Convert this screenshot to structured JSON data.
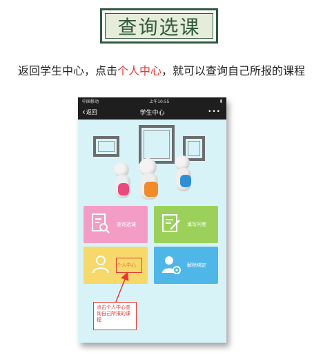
{
  "header": {
    "title": "查询选课",
    "instruction_prefix": "返回学生中心，点击",
    "instruction_highlight": "个人中心",
    "instruction_suffix": "，就可以查询自己所报的课程"
  },
  "phone": {
    "status": {
      "carrier": "中国移动",
      "time": "上午10:55"
    },
    "navbar": {
      "back_label": "返回",
      "title": "学生中心",
      "more": "•••"
    },
    "tiles": [
      {
        "label": "查询选课",
        "icon": "list-search-icon"
      },
      {
        "label": "填写问卷",
        "icon": "form-edit-icon"
      },
      {
        "label": "个人中心",
        "icon": "person-icon"
      },
      {
        "label": "解除绑定",
        "icon": "user-settings-icon"
      }
    ],
    "annotation": "点击个人中心查询自己所报的课程"
  },
  "colors": {
    "title_green": "#2f5a3b",
    "highlight_red": "#e53935",
    "tile_pink": "#f39dc6",
    "tile_green": "#9bd15a",
    "tile_yellow": "#f6d86b",
    "tile_blue": "#4fb6e8"
  }
}
